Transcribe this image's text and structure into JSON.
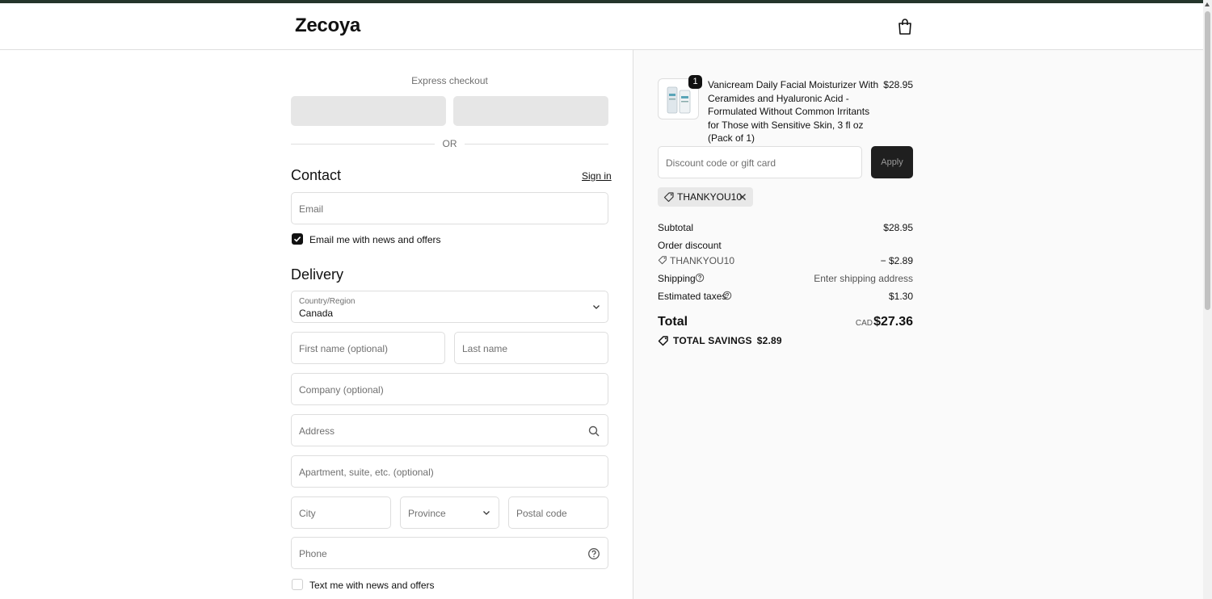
{
  "header": {
    "logo": "Zecoya",
    "cart_icon": "shopping-bag-icon"
  },
  "express": {
    "label": "Express checkout",
    "or": "OR"
  },
  "contact": {
    "title": "Contact",
    "sign_in": "Sign in",
    "email_placeholder": "Email",
    "newsletter_label": "Email me with news and offers",
    "newsletter_checked": true
  },
  "delivery": {
    "title": "Delivery",
    "country_label": "Country/Region",
    "country_value": "Canada",
    "first_name_placeholder": "First name (optional)",
    "last_name_placeholder": "Last name",
    "company_placeholder": "Company (optional)",
    "address_placeholder": "Address",
    "apartment_placeholder": "Apartment, suite, etc. (optional)",
    "city_placeholder": "City",
    "province_placeholder": "Province",
    "postal_placeholder": "Postal code",
    "phone_placeholder": "Phone",
    "sms_label": "Text me with news and offers",
    "sms_checked": false
  },
  "summary": {
    "product": {
      "name": "Vanicream Daily Facial Moisturizer With Ceramides and Hyaluronic Acid - Formulated Without Common Irritants for Those with Sensitive Skin, 3 fl oz (Pack of 1)",
      "price": "$28.95",
      "quantity": "1"
    },
    "discount_placeholder": "Discount code or gift card",
    "apply_label": "Apply",
    "applied_code": "THANKYOU10",
    "subtotal_label": "Subtotal",
    "subtotal_value": "$28.95",
    "order_discount_label": "Order discount",
    "discount_code": "THANKYOU10",
    "discount_value": "− $2.89",
    "shipping_label": "Shipping",
    "shipping_value": "Enter shipping address",
    "taxes_label": "Estimated taxes",
    "taxes_value": "$1.30",
    "total_label": "Total",
    "total_currency": "CAD",
    "total_value": "$27.36",
    "savings_label": "TOTAL SAVINGS",
    "savings_value": "$2.89"
  },
  "colors": {
    "accent_bar": "#25352b",
    "primary_dark": "#1f1f1f",
    "border": "#dedede"
  }
}
